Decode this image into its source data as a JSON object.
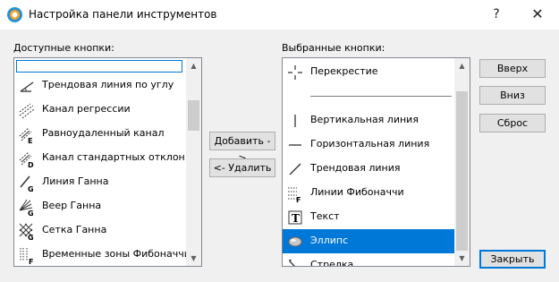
{
  "window": {
    "title": "Настройка панели инструментов",
    "help_glyph": "?",
    "close_glyph": "✕"
  },
  "available": {
    "label": "Доступные кнопки:",
    "search_value": "",
    "items": [
      {
        "label": "Трендовая линия по углу",
        "icon": "angle-trendline-icon"
      },
      {
        "label": "Канал регрессии",
        "icon": "regression-channel-icon"
      },
      {
        "label": "Равноудаленный канал",
        "icon": "equidistant-channel-icon"
      },
      {
        "label": "Канал стандартных отклон...",
        "icon": "stddev-channel-icon"
      },
      {
        "label": "Линия Ганна",
        "icon": "gann-line-icon"
      },
      {
        "label": "Веер Ганна",
        "icon": "gann-fan-icon"
      },
      {
        "label": "Сетка Ганна",
        "icon": "gann-grid-icon"
      },
      {
        "label": "Временные зоны Фибоначчи",
        "icon": "fibonacci-timezones-icon"
      }
    ]
  },
  "selected": {
    "label": "Выбранные кнопки:",
    "items": [
      {
        "label": "Перекрестие",
        "icon": "crosshair-icon"
      },
      {
        "label": "",
        "icon": "separator"
      },
      {
        "label": "Вертикальная линия",
        "icon": "vertical-line-icon"
      },
      {
        "label": "Горизонтальная линия",
        "icon": "horizontal-line-icon"
      },
      {
        "label": "Трендовая линия",
        "icon": "trendline-icon"
      },
      {
        "label": "Линии Фибоначчи",
        "icon": "fibonacci-lines-icon"
      },
      {
        "label": "Текст",
        "icon": "text-icon"
      },
      {
        "label": "Эллипс",
        "icon": "ellipse-icon"
      },
      {
        "label": "Стрелка",
        "icon": "arrow-icon"
      }
    ],
    "selected_label": "Эллипс"
  },
  "buttons": {
    "add": "Добавить ->",
    "remove": "<- Удалить",
    "up": "Вверх",
    "down": "Вниз",
    "reset": "Сброс",
    "close": "Закрыть"
  },
  "colors": {
    "selection": "#0078d7",
    "background": "#f0f0f0"
  }
}
